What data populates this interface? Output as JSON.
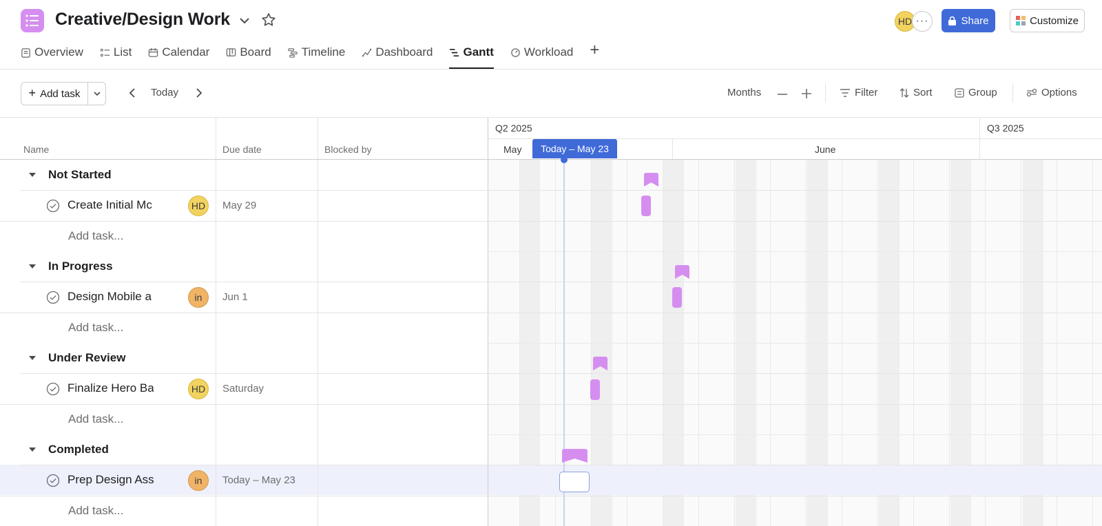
{
  "project": {
    "title": "Creative/Design Work",
    "icon": "list-icon",
    "accent": "#d58ef0"
  },
  "header": {
    "avatar_initials": "HD",
    "more": "···",
    "share_label": "Share",
    "customize_label": "Customize"
  },
  "tabs": [
    {
      "label": "Overview",
      "icon": "overview-icon"
    },
    {
      "label": "List",
      "icon": "list-icon"
    },
    {
      "label": "Calendar",
      "icon": "calendar-icon"
    },
    {
      "label": "Board",
      "icon": "board-icon"
    },
    {
      "label": "Timeline",
      "icon": "timeline-icon"
    },
    {
      "label": "Dashboard",
      "icon": "dashboard-icon"
    },
    {
      "label": "Gantt",
      "icon": "gantt-icon",
      "active": true
    },
    {
      "label": "Workload",
      "icon": "workload-icon"
    }
  ],
  "toolbar": {
    "add_task": "Add task",
    "today": "Today",
    "zoom_label": "Months",
    "filter": "Filter",
    "sort": "Sort",
    "group": "Group",
    "options": "Options"
  },
  "columns": {
    "name": "Name",
    "due": "Due date",
    "blocked": "Blocked by"
  },
  "sections": [
    {
      "label": "Not Started",
      "task": {
        "name": "Create Initial Mc",
        "assignee": "HD",
        "due": "May 29"
      },
      "add": "Add task..."
    },
    {
      "label": "In Progress",
      "task": {
        "name": "Design Mobile a",
        "assignee": "in",
        "due": "Jun 1"
      },
      "add": "Add task..."
    },
    {
      "label": "Under Review",
      "task": {
        "name": "Finalize Hero Ba",
        "assignee": "HD",
        "due": "Saturday"
      },
      "add": "Add task..."
    },
    {
      "label": "Completed",
      "task": {
        "name": "Prep Design Ass",
        "assignee": "in",
        "due": "Today – May 23"
      },
      "add": "Add task..."
    }
  ],
  "gantt": {
    "quarters": [
      "Q2 2025",
      "Q3 2025"
    ],
    "months": [
      "May",
      "June"
    ],
    "today_label": "Today – May 23",
    "colors": {
      "today": "#3f6ad8",
      "task": "#d58ef0"
    }
  }
}
